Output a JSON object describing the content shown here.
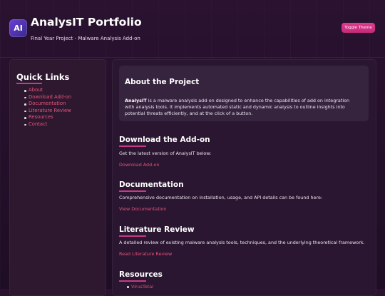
{
  "header": {
    "logo_text": "AI",
    "title": "AnalysIT Portfolio",
    "subtitle": "Final Year Project - Malware Analysis Add-on",
    "toggle_label": "Toggle Theme"
  },
  "sidebar": {
    "title": "Quick Links",
    "items": [
      {
        "label": "About"
      },
      {
        "label": "Download Add-on"
      },
      {
        "label": "Documentation"
      },
      {
        "label": "Literature Review"
      },
      {
        "label": "Resources"
      },
      {
        "label": "Contact"
      }
    ]
  },
  "about": {
    "title": "About the Project",
    "brand": "AnalysIT",
    "body": " is a malware analysis add-on designed to enhance the capabilities of add on integration with analysis tools. It implements automated static and dynamic analysis to outline insights into potential threats efficiently, and at the click of a button."
  },
  "download": {
    "title": "Download the Add-on",
    "desc": "Get the latest version of AnalysIT below:",
    "link": "Download Add-on"
  },
  "documentation": {
    "title": "Documentation",
    "desc": "Comprehensive documentation on installation, usage, and API details can be found here:",
    "link": "View Documentation"
  },
  "literature": {
    "title": "Literature Review",
    "desc": "A detailed review of existing malware analysis tools, techniques, and the underlying theoretical framework.",
    "link": "Read Literature Review"
  },
  "resources": {
    "title": "Resources",
    "items": [
      {
        "label": "VirusTotal"
      }
    ]
  },
  "colors": {
    "accent": "#c73a86",
    "link": "#e8527a",
    "button": "#d4317f",
    "background": "#241029"
  }
}
